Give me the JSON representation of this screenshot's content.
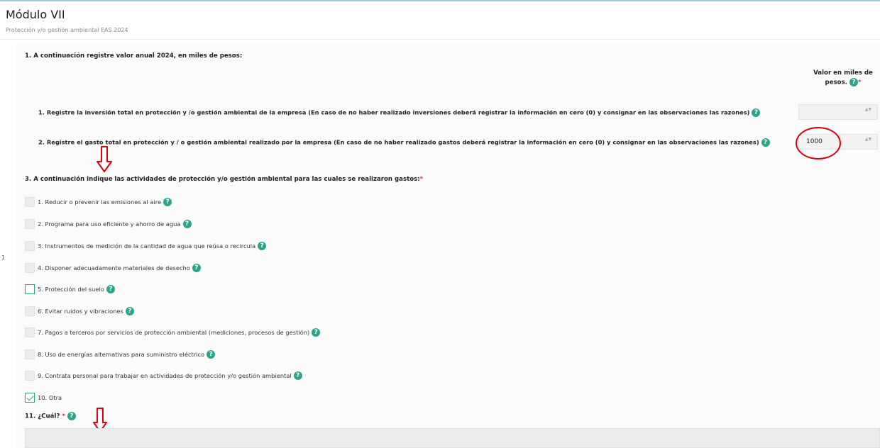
{
  "module": {
    "title": "Módulo VII",
    "subtitle": "Protección y/o gestión ambiental EAS 2024"
  },
  "q1": {
    "heading": "1. A continuación registre valor anual 2024, en miles de pesos:",
    "column_header_line1": "Valor en miles de",
    "column_header_line2": "pesos.",
    "rows": [
      {
        "label": "1. Registre la inversión total en protección y /o gestión ambiental de la empresa (En caso de no haber realizado inversiones deberá registrar la información en cero (0) y consignar en las observaciones las razones)",
        "value": ""
      },
      {
        "label": "2. Registre el gasto total en protección y / o gestión ambiental realizado por la empresa (En caso de no haber realizado gastos deberá registrar la información en cero (0) y consignar en las observaciones las razones)",
        "value": "1000"
      }
    ]
  },
  "q3": {
    "heading": "3. A continuación indique las actividades de protección y/o gestión ambiental para las cuales se realizaron gastos:",
    "options": [
      {
        "label": "1. Reducir o prevenir las emisiones al aire",
        "checked": false,
        "help": true
      },
      {
        "label": "2. Programa para uso eficiente y ahorro de agua",
        "checked": false,
        "help": true
      },
      {
        "label": "3. Instrumentos de medición de la cantidad de agua que reúsa o recircula",
        "checked": false,
        "help": true
      },
      {
        "label": "4. Disponer adecuadamente materiales de desecho",
        "checked": false,
        "help": true
      },
      {
        "label": "5. Protección del suelo",
        "checked": false,
        "help": true
      },
      {
        "label": "6. Evitar ruidos y vibraciones",
        "checked": false,
        "help": true
      },
      {
        "label": "7. Pagos a terceros por servicios de protección ambiental (mediciones, procesos de gestión)",
        "checked": false,
        "help": true
      },
      {
        "label": "8. Uso de energías alternativas para suministro eléctrico",
        "checked": false,
        "help": true
      },
      {
        "label": "9. Contrata personal para trabajar en actividades de protección y/o gestión ambiental",
        "checked": false,
        "help": true
      },
      {
        "label": "10. Otra",
        "checked": true,
        "help": false
      }
    ]
  },
  "q11": {
    "label": "11. ¿Cuál?",
    "value": ""
  },
  "help_glyph": "?",
  "required_mark": "*",
  "spinner_glyph": "▲▼",
  "edge_text": "1",
  "colors": {
    "accent": "#2aa58a",
    "required": "#e0316b",
    "annotation": "#d8000b"
  }
}
